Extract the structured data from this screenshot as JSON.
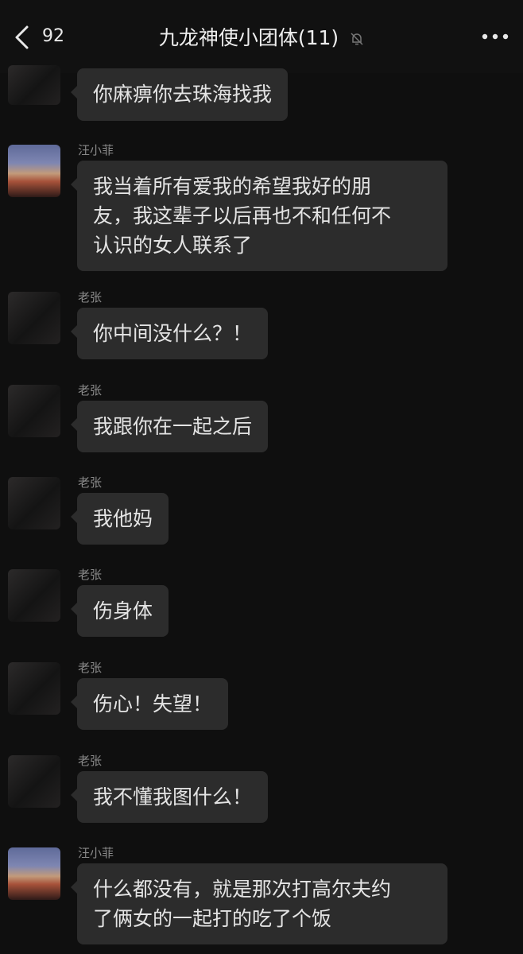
{
  "header": {
    "back_count": "92",
    "title": "九龙神使小团体(11)"
  },
  "icons": {
    "back": "chevron-left-icon",
    "mute": "bell-off-icon",
    "more": "more-horizontal-icon"
  },
  "messages": [
    {
      "sender": "",
      "avatar": "dark",
      "text": "你麻痹你去珠海找我"
    },
    {
      "sender": "汪小菲",
      "avatar": "sunset",
      "text": "我当着所有爱我的希望我好的朋\n友，我这辈子以后再也不和任何不\n认识的女人联系了"
    },
    {
      "sender": "老张",
      "avatar": "dark",
      "text": "你中间没什么？！"
    },
    {
      "sender": "老张",
      "avatar": "dark",
      "text": "我跟你在一起之后"
    },
    {
      "sender": "老张",
      "avatar": "dark",
      "text": "我他妈"
    },
    {
      "sender": "老张",
      "avatar": "dark",
      "text": "伤身体"
    },
    {
      "sender": "老张",
      "avatar": "dark",
      "text": "伤心！失望！"
    },
    {
      "sender": "老张",
      "avatar": "dark",
      "text": "我不懂我图什么！"
    },
    {
      "sender": "汪小菲",
      "avatar": "sunset",
      "text": "什么都没有，就是那次打高尔夫约\n了俩女的一起打的吃了个饭"
    }
  ],
  "colors": {
    "background": "#0f0f0f",
    "bubble": "#2c2c2c",
    "text": "#e4e4e4",
    "sender": "#8a8a8a"
  }
}
